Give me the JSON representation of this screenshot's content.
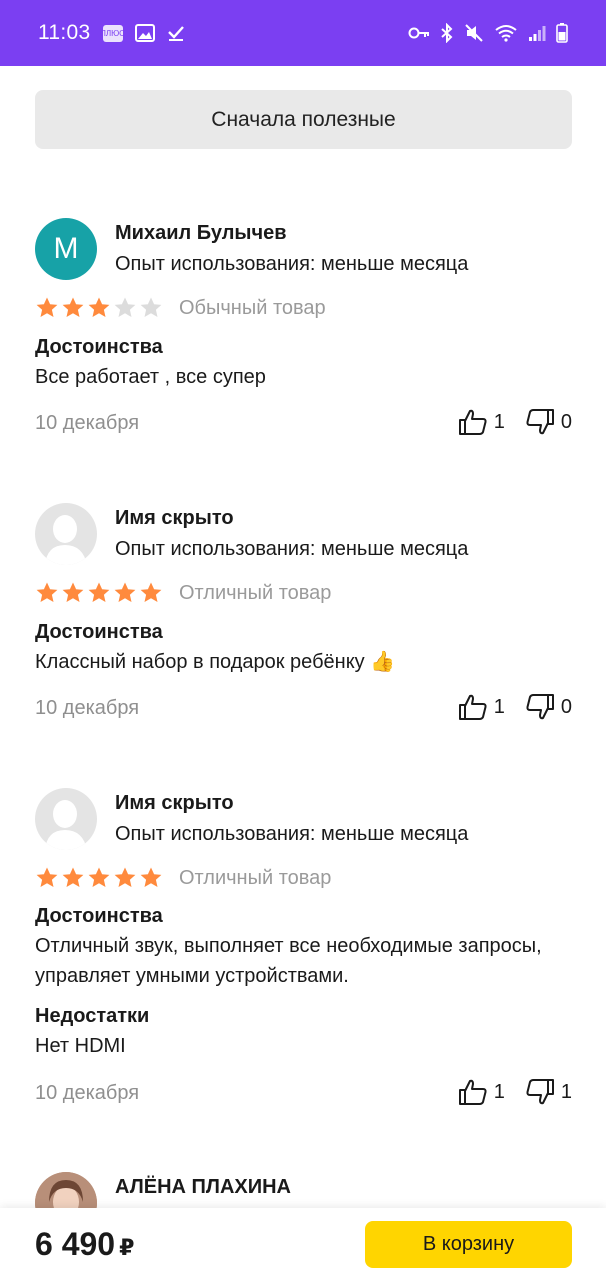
{
  "status_bar": {
    "time": "11:03",
    "mini_label": "ПЛЮС"
  },
  "sort": {
    "label": "Сначала полезные"
  },
  "reviews": [
    {
      "avatar_letter": "М",
      "author": "Михаил Булычев",
      "experience": "Опыт использования: меньше месяца",
      "rating": 3,
      "verdict": "Обычный товар",
      "pros_title": "Достоинства",
      "pros_text": "Все работает , все супер",
      "date": "10 декабря",
      "likes": "1",
      "dislikes": "0"
    },
    {
      "author": "Имя скрыто",
      "experience": "Опыт использования: меньше месяца",
      "rating": 5,
      "verdict": "Отличный товар",
      "pros_title": "Достоинства",
      "pros_text": "Классный набор в подарок ребёнку 👍",
      "date": "10 декабря",
      "likes": "1",
      "dislikes": "0"
    },
    {
      "author": "Имя скрыто",
      "experience": "Опыт использования: меньше месяца",
      "rating": 5,
      "verdict": "Отличный товар",
      "pros_title": "Достоинства",
      "pros_text": "Отличный звук, выполняет все необходимые запросы, управляет умными устройствами.",
      "cons_title": "Недостатки",
      "cons_text": "Нет HDMI",
      "date": "10 декабря",
      "likes": "1",
      "dislikes": "1"
    },
    {
      "author": "АЛЁНА ПЛАХИНА"
    }
  ],
  "bottom_bar": {
    "price": "6 490",
    "currency": "₽",
    "cart_label": "В корзину"
  },
  "colors": {
    "accent": "#7b3ff2",
    "star_filled": "#ff8a3d",
    "star_empty": "#dcdcdc",
    "cart_button": "#ffd500"
  }
}
